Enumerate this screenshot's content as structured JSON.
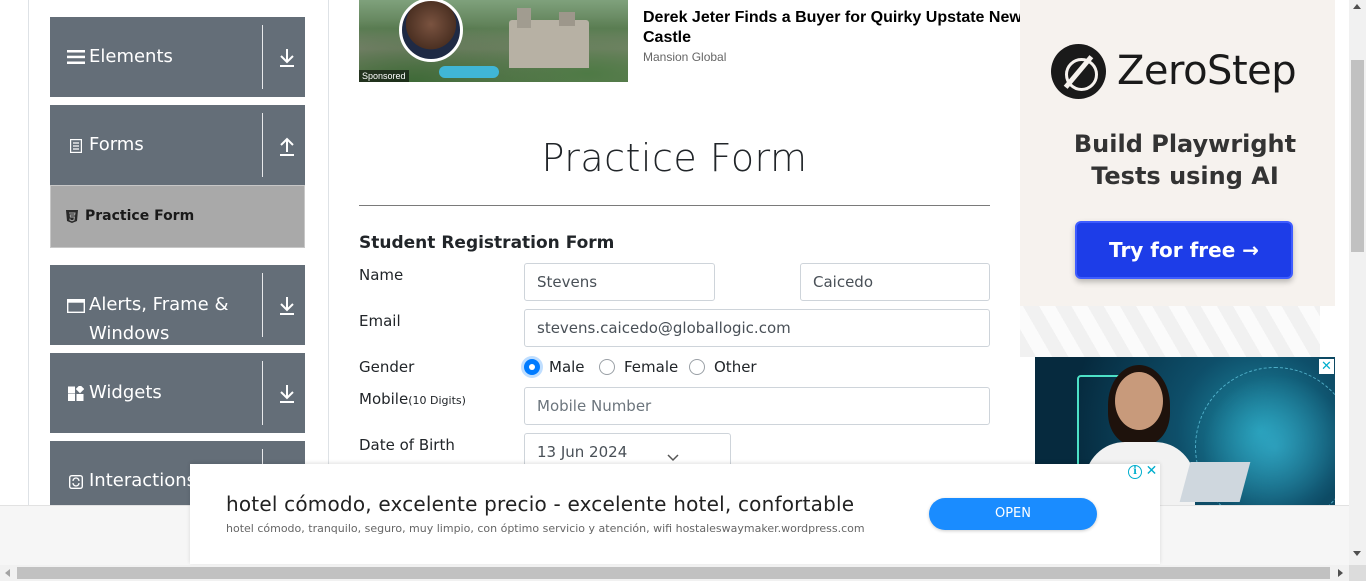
{
  "sidebar": {
    "groups": [
      {
        "label": "Elements",
        "icon": "hamburger-icon",
        "expanded": false
      },
      {
        "label": "Forms",
        "icon": "document-icon",
        "expanded": true
      },
      {
        "label": "Alerts, Frame & Windows",
        "icon": "window-icon",
        "expanded": false
      },
      {
        "label": "Widgets",
        "icon": "widgets-icon",
        "expanded": false
      },
      {
        "label": "Interactions",
        "icon": "interactions-icon",
        "expanded": false
      }
    ],
    "active_item": {
      "label": "Practice Form",
      "icon": "html5-icon"
    }
  },
  "sponsored": {
    "tag": "Sponsored",
    "title": "Derek Jeter Finds a Buyer for Quirky Upstate New Castle",
    "source": "Mansion Global"
  },
  "main": {
    "title": "Practice Form",
    "form_heading": "Student Registration Form",
    "labels": {
      "name": "Name",
      "email": "Email",
      "gender": "Gender",
      "mobile": "Mobile",
      "mobile_hint": "(10 Digits)",
      "dob": "Date of Birth"
    },
    "fields": {
      "first_name": "Stevens",
      "last_name": "Caicedo",
      "email": "stevens.caicedo@globallogic.com",
      "mobile_placeholder": "Mobile Number",
      "dob": "13 Jun 2024"
    },
    "gender_options": [
      {
        "label": "Male",
        "checked": true
      },
      {
        "label": "Female",
        "checked": false
      },
      {
        "label": "Other",
        "checked": false
      }
    ]
  },
  "right_ad": {
    "brand": "ZeroStep",
    "tagline": "Build Playwright Tests using AI",
    "cta": "Try for free →"
  },
  "bottom_banner": {
    "title": "hotel cómodo, excelente precio - excelente hotel, confortable",
    "subtitle": "hotel cómodo, tranquilo, seguro, muy limpio, con óptimo servicio y atención, wifi hostaleswaymaker.wordpress.com",
    "cta": "OPEN"
  },
  "colors": {
    "sidebar_group": "#646e78",
    "active_item": "#a9a9a9",
    "accent": "#007bff",
    "zerostep_button": "#1d3de8",
    "banner_button": "#1a8cff"
  }
}
